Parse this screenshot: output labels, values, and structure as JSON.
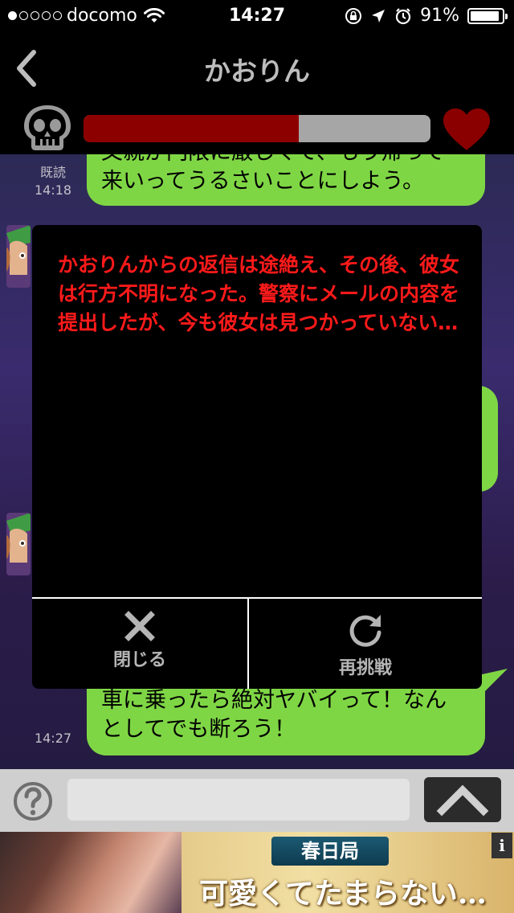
{
  "status_bar": {
    "signal_dots_filled": 1,
    "signal_dots_total": 5,
    "carrier": "docomo",
    "time": "14:27",
    "battery_percent": "91%",
    "battery_level": 0.91
  },
  "nav": {
    "title": "かおりん",
    "back_icon": "chevron-left-icon"
  },
  "gauge": {
    "left_icon": "skull-icon",
    "right_icon": "heart-icon",
    "fill_fraction": 0.62,
    "fill_color": "#8d0000",
    "track_color": "#a6a6a6"
  },
  "chat": {
    "messages": [
      {
        "side": "right",
        "lines": [
          "父親が門限に厳しくて、もう帰って",
          "来いってうるさいことにしよう。"
        ],
        "read": "既読",
        "time": "14:18"
      },
      {
        "side": "right",
        "lines": [
          "車に乗ったら絶対ヤバイって！なん",
          "としてでも断ろう！"
        ],
        "time": "14:27"
      }
    ]
  },
  "modal": {
    "message": "かおりんからの返信は途絶え、その後、彼女は行方不明になった。警察にメールの内容を提出したが、今も彼女は見つかっていない…",
    "message_color": "#ff1a1a",
    "close_label": "閉じる",
    "close_icon": "close-icon",
    "retry_label": "再挑戦",
    "retry_icon": "retry-icon"
  },
  "input_bar": {
    "help_icon": "help-icon",
    "placeholder": "",
    "send_icon": "chevron-up-icon"
  },
  "ad": {
    "tag": "春日局",
    "headline": "可愛くてたまらない…",
    "info_label": "i"
  }
}
